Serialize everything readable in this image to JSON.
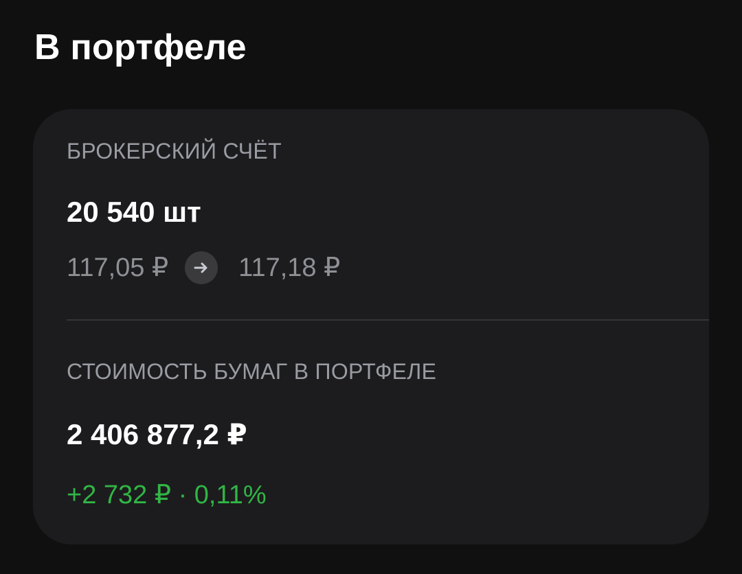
{
  "section": {
    "title": "В портфеле"
  },
  "broker_account": {
    "caption": "БРОКЕРСКИЙ СЧЁТ",
    "quantity": "20 540 шт",
    "price_from": "117,05 ₽",
    "price_to": "117,18 ₽",
    "arrow_icon": "arrow-right-icon"
  },
  "portfolio_value": {
    "caption": "СТОИМОСТЬ БУМАГ В ПОРТФЕЛЕ",
    "value": "2 406 877,2 ₽",
    "change": "+2 732 ₽ · 0,11%",
    "change_color": "#31b545"
  },
  "colors": {
    "background": "#101010",
    "card": "#1c1c1e",
    "caption": "#9a9ca3",
    "muted_value": "#8e9096",
    "positive": "#31b545"
  }
}
